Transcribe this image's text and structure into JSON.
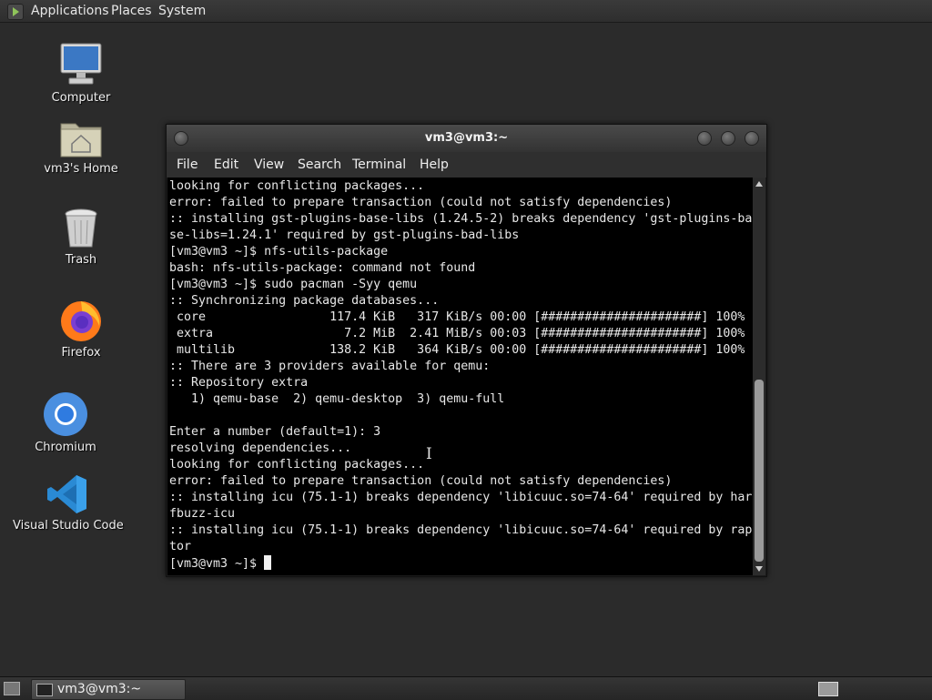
{
  "top_panel": {
    "menus": [
      "Applications",
      "Places",
      "System"
    ]
  },
  "desktop": {
    "icons": [
      {
        "label": "Computer",
        "icon": "computer-icon"
      },
      {
        "label": "vm3's Home",
        "icon": "home-folder-icon"
      },
      {
        "label": "Trash",
        "icon": "trash-icon"
      },
      {
        "label": "Firefox",
        "icon": "firefox-icon"
      },
      {
        "label": "Chromium",
        "icon": "chromium-icon"
      },
      {
        "label": "Visual Studio Code",
        "icon": "vscode-icon"
      }
    ]
  },
  "terminal": {
    "title": "vm3@vm3:~",
    "menu": [
      "File",
      "Edit",
      "View",
      "Search",
      "Terminal",
      "Help"
    ],
    "lines": [
      "looking for conflicting packages...",
      "error: failed to prepare transaction (could not satisfy dependencies)",
      ":: installing gst-plugins-base-libs (1.24.5-2) breaks dependency 'gst-plugins-ba",
      "se-libs=1.24.1' required by gst-plugins-bad-libs",
      "[vm3@vm3 ~]$ nfs-utils-package",
      "bash: nfs-utils-package: command not found",
      "[vm3@vm3 ~]$ sudo pacman -Syy qemu",
      ":: Synchronizing package databases...",
      " core                 117.4 KiB   317 KiB/s 00:00 [######################] 100%",
      " extra                  7.2 MiB  2.41 MiB/s 00:03 [######################] 100%",
      " multilib             138.2 KiB   364 KiB/s 00:00 [######################] 100%",
      ":: There are 3 providers available for qemu:",
      ":: Repository extra",
      "   1) qemu-base  2) qemu-desktop  3) qemu-full",
      "",
      "Enter a number (default=1): 3",
      "resolving dependencies...",
      "looking for conflicting packages...",
      "error: failed to prepare transaction (could not satisfy dependencies)",
      ":: installing icu (75.1-1) breaks dependency 'libicuuc.so=74-64' required by har",
      "fbuzz-icu",
      ":: installing icu (75.1-1) breaks dependency 'libicuuc.so=74-64' required by rap",
      "tor"
    ],
    "prompt": "[vm3@vm3 ~]$ "
  },
  "bottom_panel": {
    "task_label": "vm3@vm3:~"
  }
}
